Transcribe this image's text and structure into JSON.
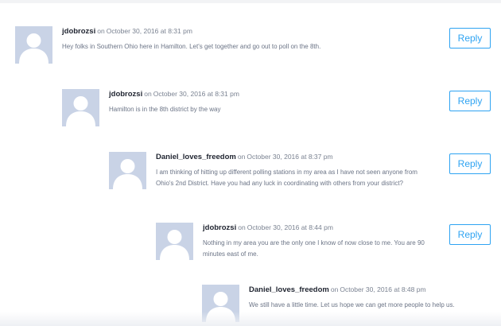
{
  "comments": [
    {
      "author": "jdobrozsi",
      "on": "on",
      "date": "October 30, 2016 at 8:31 pm",
      "text": "Hey folks in Southern Ohio here in Hamilton. Let's get together and go out to poll on the 8th.",
      "reply_label": "Reply"
    },
    {
      "author": "jdobrozsi",
      "on": "on",
      "date": "October 30, 2016 at 8:31 pm",
      "text": "Hamilton is in the 8th district by the way",
      "reply_label": "Reply"
    },
    {
      "author": "Daniel_loves_freedom",
      "on": "on",
      "date": "October 30, 2016 at 8:37 pm",
      "text": "I am thinking of hitting up different polling stations in my area as I have not seen anyone from Ohio's 2nd District. Have you had any luck in coordinating with others from your district?",
      "reply_label": "Reply"
    },
    {
      "author": "jdobrozsi",
      "on": "on",
      "date": "October 30, 2016 at 8:44 pm",
      "text": "Nothing in my area you are the only one I know of now close to me. You are 90 minutes east of me.",
      "reply_label": "Reply"
    },
    {
      "author": "Daniel_loves_freedom",
      "on": "on",
      "date": "October 30, 2016 at 8:48 pm",
      "text": "We still have a little time. Let us hope we can get more people to help us."
    }
  ],
  "colors": {
    "accent": "#2ea3f2",
    "avatar_bg": "#c9d3e6",
    "author": "#1f2430",
    "meta": "#7a8291"
  },
  "icons": {
    "avatar": "default-avatar-icon"
  }
}
